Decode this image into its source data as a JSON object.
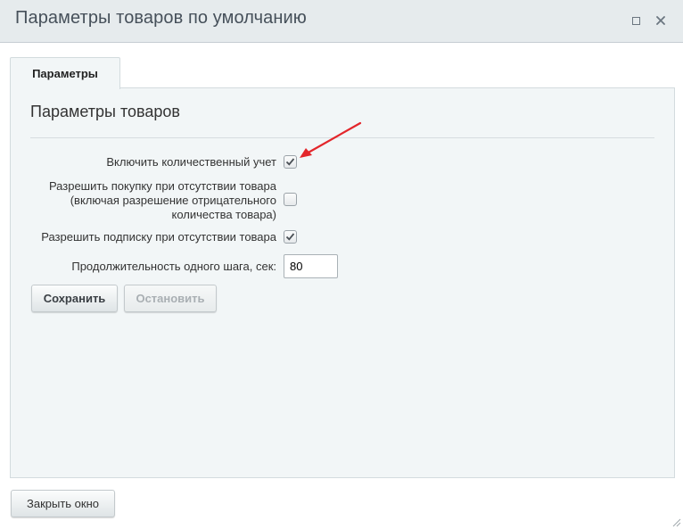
{
  "window": {
    "title": "Параметры товаров по умолчанию",
    "maximize_icon": "maximize-icon",
    "close_icon": "close-icon"
  },
  "tabs": [
    {
      "label": "Параметры",
      "active": true
    }
  ],
  "section": {
    "title": "Параметры товаров"
  },
  "fields": {
    "quantity_accounting": {
      "label": "Включить количественный учет",
      "checked": true
    },
    "allow_purchase": {
      "label_line1": "Разрешить покупку при отсутствии товара",
      "label_line2": "(включая разрешение отрицательного",
      "label_line3": "количества товара)",
      "checked": false
    },
    "allow_subscribe": {
      "label": "Разрешить подписку при отсутствии товара",
      "checked": true
    },
    "step_duration": {
      "label": "Продолжительность одного шага, сек:",
      "value": "80"
    }
  },
  "buttons": {
    "save": "Сохранить",
    "stop": "Остановить",
    "close_window": "Закрыть окно"
  },
  "colors": {
    "annotation_arrow": "#e3262b",
    "titlebar": "#e6ebed",
    "panel": "#f2f6f7"
  }
}
